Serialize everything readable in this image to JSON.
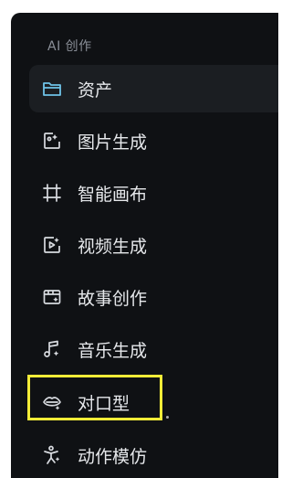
{
  "sidebar": {
    "section_title": "AI 创作",
    "items": [
      {
        "label": "资产",
        "icon": "folder-icon",
        "active": true
      },
      {
        "label": "图片生成",
        "icon": "image-sparkle-icon"
      },
      {
        "label": "智能画布",
        "icon": "crop-frame-icon"
      },
      {
        "label": "视频生成",
        "icon": "video-sparkle-icon"
      },
      {
        "label": "故事创作",
        "icon": "storyboard-icon"
      },
      {
        "label": "音乐生成",
        "icon": "music-note-icon"
      },
      {
        "label": "对口型",
        "icon": "lip-sync-icon"
      },
      {
        "label": "动作模仿",
        "icon": "motion-figure-icon"
      }
    ]
  },
  "colors": {
    "panel_background": "#0f1114",
    "active_item_background": "#1b1e22",
    "accent": "#6fc3e8",
    "highlight_border": "#f2ec38"
  }
}
